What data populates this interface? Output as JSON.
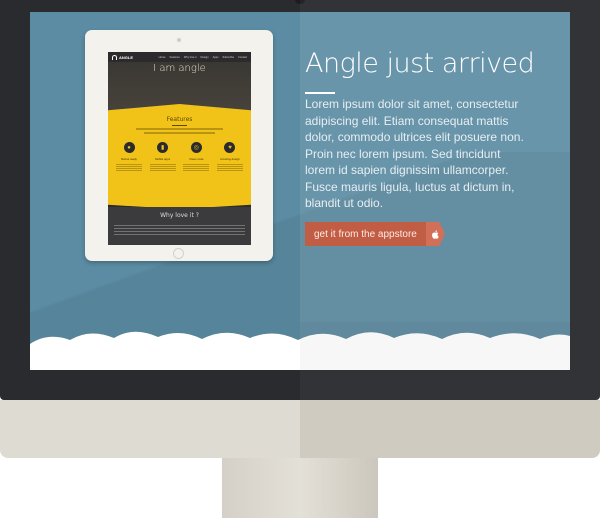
{
  "hero": {
    "title": "Angle just arrived",
    "body": "Lorem ipsum dolor sit amet, consectetur adipiscing elit. Etiam consequat mattis dolor, commodo ultrices elit posuere non. Proin nec lorem ipsum. Sed tincidunt lorem id sapien dignissim ullamcorper. Fusce mauris ligula, luctus at dictum in, blandit ut odio.",
    "cta_label": "get it from the appstore",
    "cta_icon": "apple-icon"
  },
  "tablet_preview": {
    "logo_text": "ANGLE",
    "nav_links": [
      "Home",
      "Features",
      "Why love it",
      "Design",
      "Apps",
      "Subscribe",
      "Contact"
    ],
    "hero_title": "I am angle",
    "features_title": "Features",
    "features": [
      {
        "name": "Retina ready",
        "icon": "eye-icon",
        "glyph": "●"
      },
      {
        "name": "Mobile apps",
        "icon": "mobile-icon",
        "glyph": "▮"
      },
      {
        "name": "Clean code",
        "icon": "code-icon",
        "glyph": "◎"
      },
      {
        "name": "Amazing design",
        "icon": "heart-icon",
        "glyph": "♥"
      }
    ],
    "why_title": "Why love it ?"
  },
  "colors": {
    "screen_bg": "#5b8ca3",
    "cta_bg": "#c0573e",
    "accent_yellow": "#f1c319",
    "monitor_frame": "#2a2b2f",
    "monitor_chin": "#dedbd2"
  }
}
